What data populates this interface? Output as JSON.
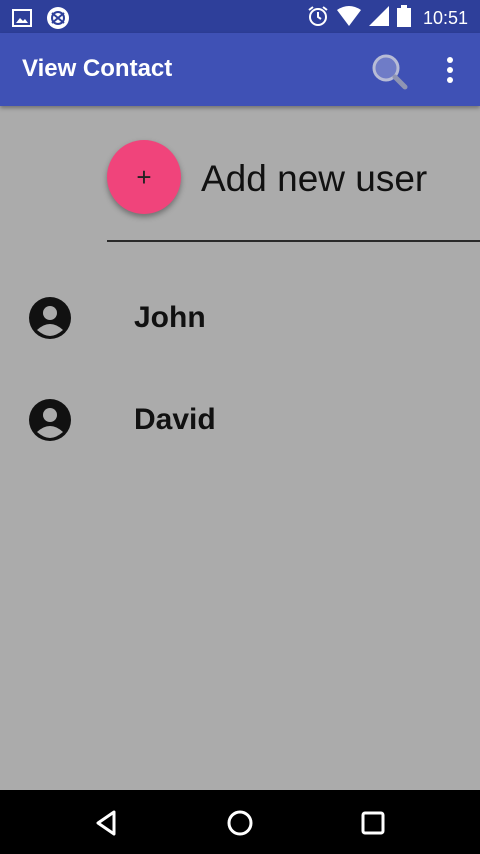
{
  "status_bar": {
    "time": "10:51",
    "icons_left": [
      "image-icon",
      "aperture-icon"
    ],
    "icons_right": [
      "alarm-icon",
      "wifi-icon",
      "signal-icon",
      "battery-icon"
    ]
  },
  "app_bar": {
    "title": "View Contact",
    "search_icon": "search-icon",
    "menu_icon": "more-vert-icon",
    "color": "#3f51b5"
  },
  "add_user": {
    "fab_symbol": "+",
    "label": "Add new user",
    "fab_color": "#f0447b"
  },
  "contacts": [
    {
      "name": "John"
    },
    {
      "name": "David"
    }
  ],
  "nav_bar": {
    "buttons": [
      "back-icon",
      "home-icon",
      "recents-icon"
    ]
  }
}
